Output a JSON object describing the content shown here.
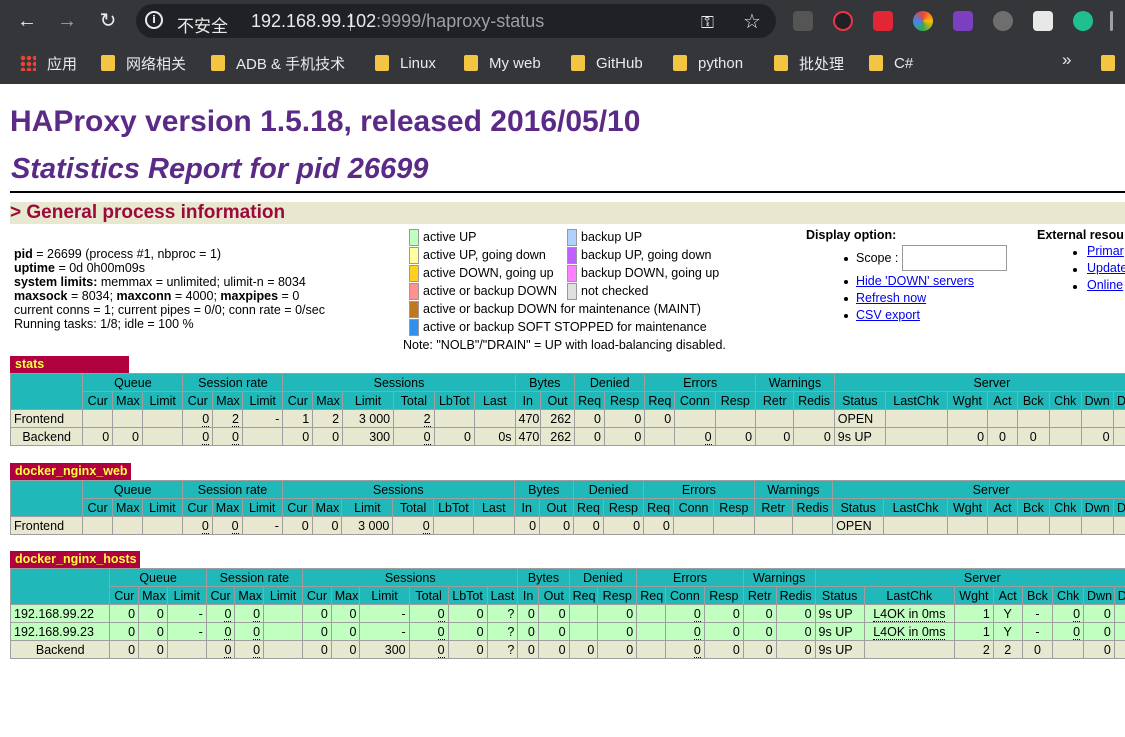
{
  "browser": {
    "nav": {
      "back": "←",
      "forward": "→",
      "reload": "↻"
    },
    "address": {
      "security_label": "不安全",
      "host": "192.168.99.102",
      "rest": ":9999/haproxy-status"
    },
    "bookmarks": [
      {
        "label": "应用",
        "icon": "apps-icon"
      },
      {
        "label": "网络相关",
        "icon": "folder-icon"
      },
      {
        "label": "ADB & 手机技术",
        "icon": "folder-icon"
      },
      {
        "label": "Linux",
        "icon": "folder-icon"
      },
      {
        "label": "My web",
        "icon": "folder-icon"
      },
      {
        "label": "GitHub",
        "icon": "folder-icon"
      },
      {
        "label": "python",
        "icon": "folder-icon"
      },
      {
        "label": "批处理",
        "icon": "folder-icon"
      },
      {
        "label": "C#",
        "icon": "folder-icon"
      }
    ],
    "more": "»"
  },
  "page": {
    "title": "HAProxy version 1.5.18, released 2016/05/10",
    "subtitle": "Statistics Report for pid 26699",
    "section": "> General process information",
    "process": [
      {
        "key": "pid",
        "value": " = 26699 (process #1, nbproc = 1)"
      },
      {
        "key": "uptime",
        "value": " = 0d 0h00m09s"
      },
      {
        "key": "system limits:",
        "value": " memmax = unlimited; ulimit-n = 8034"
      },
      {
        "key": "maxsock",
        "value": " = 8034; ",
        "key2": "maxconn",
        "value2": " = 4000; ",
        "key3": "maxpipes",
        "value3": " = 0"
      },
      {
        "key": "",
        "value": "current conns = 1; current pipes = 0/0; conn rate = 0/sec"
      },
      {
        "key": "",
        "value": "Running tasks: 1/8; idle = 100 %"
      }
    ],
    "legend": {
      "left": [
        {
          "label": "active UP",
          "color": "#c0ffc0"
        },
        {
          "label": "active UP, going down",
          "color": "#ffffa0"
        },
        {
          "label": "active DOWN, going up",
          "color": "#ffd020"
        },
        {
          "label": "active or backup DOWN",
          "color": "#ff9090"
        },
        {
          "label": "active or backup DOWN for maintenance (MAINT)",
          "color": "#c07820"
        },
        {
          "label": "active or backup SOFT STOPPED for maintenance",
          "color": "#3090f0"
        }
      ],
      "right": [
        {
          "label": "backup UP",
          "color": "#b0d0ff"
        },
        {
          "label": "backup UP, going down",
          "color": "#c060ff"
        },
        {
          "label": "backup DOWN, going up",
          "color": "#ff80ff"
        },
        {
          "label": "not checked",
          "color": "#e0e0e0"
        }
      ],
      "note": "Note: \"NOLB\"/\"DRAIN\" = UP with load-balancing disabled."
    },
    "display_option": {
      "title": "Display option:",
      "scope_label": "Scope :",
      "links": [
        "Hide 'DOWN' servers",
        "Refresh now",
        "CSV export"
      ]
    },
    "external": {
      "title": "External resou",
      "links": [
        "Primar",
        "Update",
        "Online"
      ]
    }
  },
  "tables": {
    "group_headers": {
      "queue": "Queue",
      "session_rate": "Session rate",
      "sessions": "Sessions",
      "bytes": "Bytes",
      "denied": "Denied",
      "errors": "Errors",
      "warnings": "Warnings",
      "server": "Server"
    },
    "columns": [
      "Cur",
      "Max",
      "Limit",
      "Cur",
      "Max",
      "Limit",
      "Cur",
      "Max",
      "Limit",
      "Total",
      "LbTot",
      "Last",
      "In",
      "Out",
      "Req",
      "Resp",
      "Req",
      "Conn",
      "Resp",
      "Retr",
      "Redis",
      "Status",
      "LastChk",
      "Wght",
      "Act",
      "Bck",
      "Chk",
      "Dwn",
      "Dwnt"
    ],
    "stats": {
      "name": "stats",
      "rows": [
        {
          "type": "frontend",
          "cells": [
            "Frontend",
            "",
            "",
            "",
            "0",
            "2",
            "-",
            "1",
            "2",
            "3 000",
            "2",
            "",
            "",
            "470",
            "262",
            "0",
            "0",
            "0",
            "",
            "",
            "",
            "",
            "OPEN",
            "",
            "",
            "",
            "",
            "",
            "",
            ""
          ]
        },
        {
          "type": "backend",
          "cells": [
            "Backend",
            "0",
            "0",
            "",
            "0",
            "0",
            "",
            "0",
            "0",
            "300",
            "0",
            "0",
            "0s",
            "470",
            "262",
            "0",
            "0",
            "",
            "0",
            "0",
            "0",
            "0",
            "9s UP",
            "",
            "0",
            "0",
            "0",
            "",
            "0",
            ""
          ]
        }
      ]
    },
    "web": {
      "name": "docker_nginx_web",
      "rows": [
        {
          "type": "frontend",
          "cells": [
            "Frontend",
            "",
            "",
            "",
            "0",
            "0",
            "-",
            "0",
            "0",
            "3 000",
            "0",
            "",
            "",
            "0",
            "0",
            "0",
            "0",
            "0",
            "",
            "",
            "",
            "",
            "OPEN",
            "",
            "",
            "",
            "",
            "",
            "",
            ""
          ]
        }
      ]
    },
    "hosts": {
      "name": "docker_nginx_hosts",
      "rows": [
        {
          "type": "srv",
          "cells": [
            "192.168.99.22",
            "0",
            "0",
            "-",
            "0",
            "0",
            "",
            "0",
            "0",
            "-",
            "0",
            "0",
            "?",
            "0",
            "0",
            "",
            "0",
            "",
            "0",
            "0",
            "0",
            "0",
            "9s UP",
            "L4OK in 0ms",
            "1",
            "Y",
            "-",
            "0",
            "0",
            ""
          ]
        },
        {
          "type": "srv",
          "cells": [
            "192.168.99.23",
            "0",
            "0",
            "-",
            "0",
            "0",
            "",
            "0",
            "0",
            "-",
            "0",
            "0",
            "?",
            "0",
            "0",
            "",
            "0",
            "",
            "0",
            "0",
            "0",
            "0",
            "9s UP",
            "L4OK in 0ms",
            "1",
            "Y",
            "-",
            "0",
            "0",
            ""
          ]
        },
        {
          "type": "backend",
          "cells": [
            "Backend",
            "0",
            "0",
            "",
            "0",
            "0",
            "",
            "0",
            "0",
            "300",
            "0",
            "0",
            "?",
            "0",
            "0",
            "0",
            "0",
            "",
            "0",
            "0",
            "0",
            "0",
            "9s UP",
            "",
            "2",
            "2",
            "0",
            "",
            "0",
            ""
          ]
        }
      ]
    }
  }
}
